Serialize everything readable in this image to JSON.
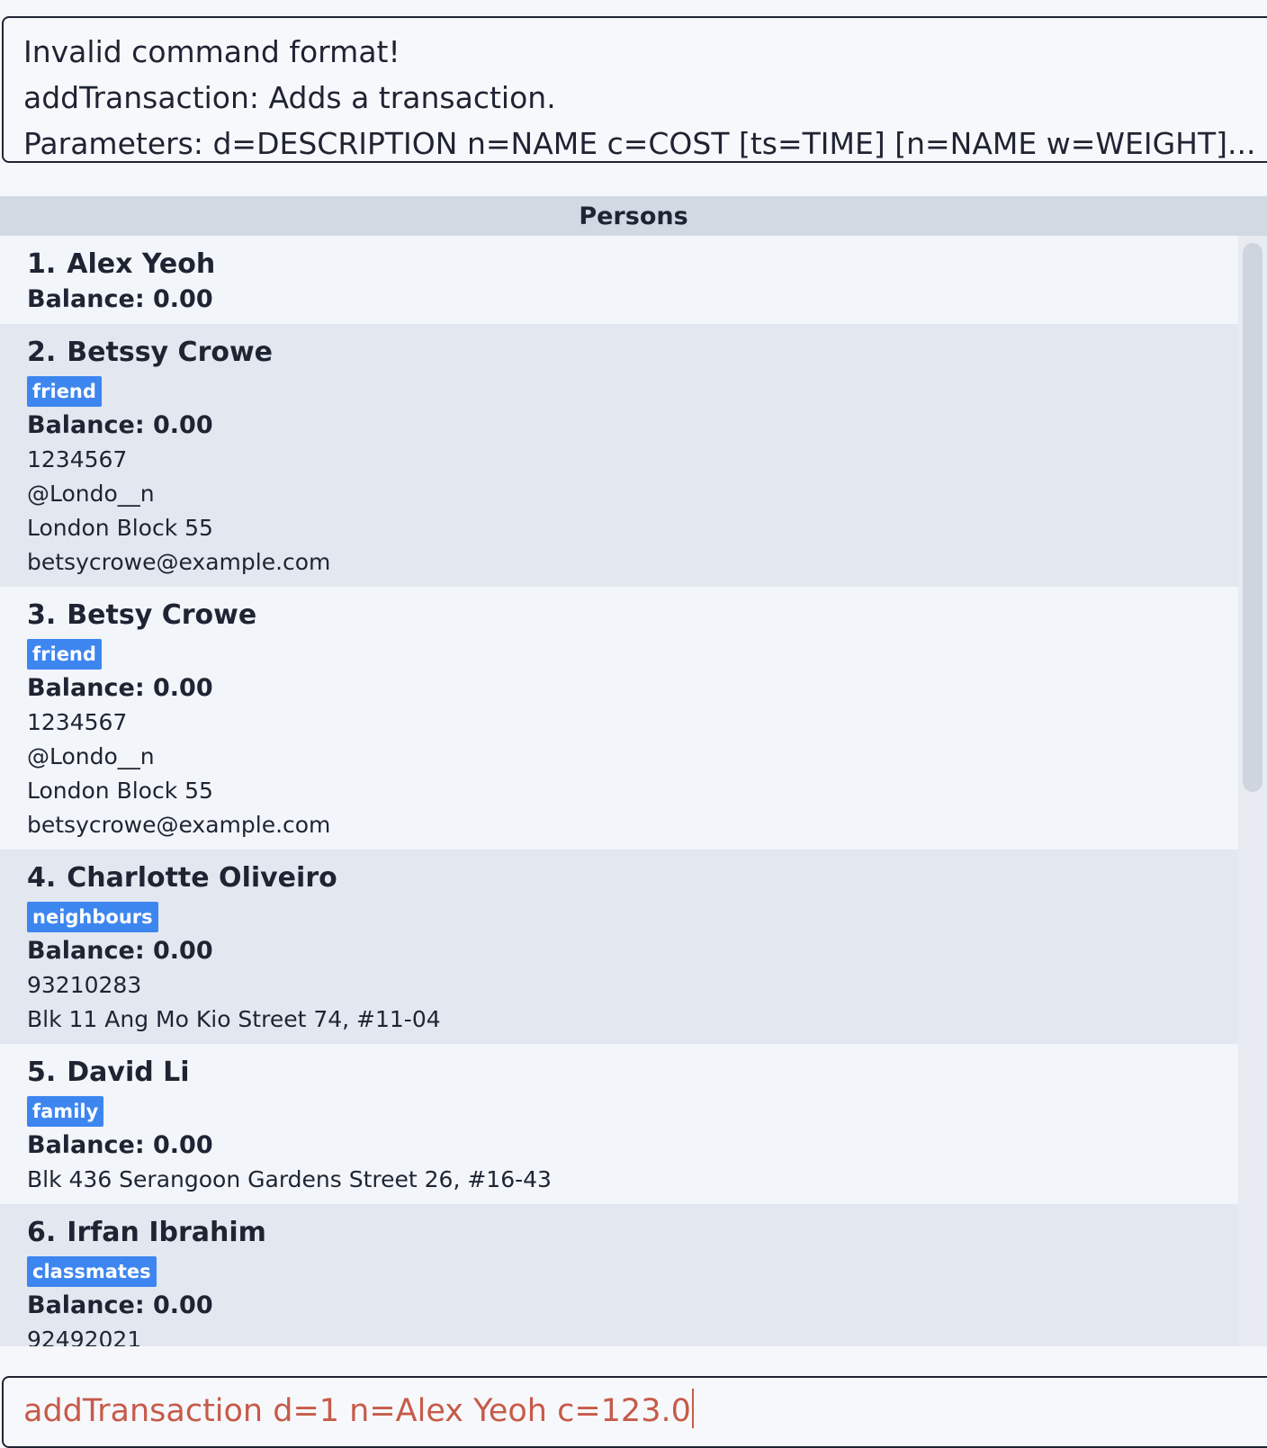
{
  "result_display": {
    "lines": [
      "Invalid command format!",
      "addTransaction: Adds a transaction.",
      "Parameters: d=DESCRIPTION n=NAME c=COST [ts=TIME] [n=NAME w=WEIGHT]..."
    ]
  },
  "persons_panel": {
    "title": "Persons"
  },
  "persons": [
    {
      "index": "1.",
      "name": "Alex Yeoh",
      "tags": [],
      "balance": "Balance: 0.00",
      "details": []
    },
    {
      "index": "2.",
      "name": "Betssy Crowe",
      "tags": [
        "friend"
      ],
      "balance": "Balance: 0.00",
      "details": [
        "1234567",
        "@Londo__n",
        "London Block 55",
        "betsycrowe@example.com"
      ]
    },
    {
      "index": "3.",
      "name": "Betsy Crowe",
      "tags": [
        "friend"
      ],
      "balance": "Balance: 0.00",
      "details": [
        "1234567",
        "@Londo__n",
        "London Block 55",
        "betsycrowe@example.com"
      ]
    },
    {
      "index": "4.",
      "name": "Charlotte Oliveiro",
      "tags": [
        "neighbours"
      ],
      "balance": "Balance: 0.00",
      "details": [
        "93210283",
        "Blk 11 Ang Mo Kio Street 74, #11-04"
      ]
    },
    {
      "index": "5.",
      "name": "David Li",
      "tags": [
        "family"
      ],
      "balance": "Balance: 0.00",
      "details": [
        "Blk 436 Serangoon Gardens Street 26, #16-43"
      ]
    },
    {
      "index": "6.",
      "name": "Irfan Ibrahim",
      "tags": [
        "classmates"
      ],
      "balance": "Balance: 0.00",
      "details": [
        "92492021"
      ]
    }
  ],
  "command_box": {
    "value": "addTransaction d=1 n=Alex Yeoh c=123.0"
  },
  "colors": {
    "tag_background": "#3d86f0",
    "command_text": "#c65b4a",
    "header_background": "#d3d9e3"
  }
}
